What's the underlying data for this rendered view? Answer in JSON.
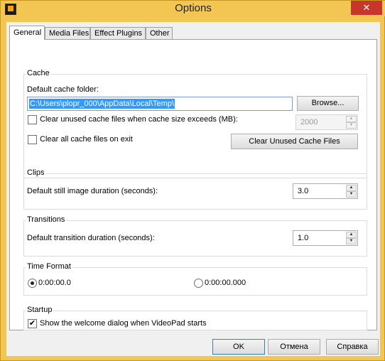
{
  "window": {
    "title": "Options",
    "close_glyph": "✕",
    "app_icon": "videopad-icon"
  },
  "tabs": [
    {
      "label": "General",
      "active": true
    },
    {
      "label": "Media Files",
      "active": false
    },
    {
      "label": "Effect Plugins",
      "active": false
    },
    {
      "label": "Other",
      "active": false
    }
  ],
  "cache": {
    "group_title": "Cache",
    "folder_label": "Default cache folder:",
    "folder_value": "C:\\Users\\plopr_000\\AppData\\Local\\Temp\\",
    "browse_label": "Browse...",
    "clear_unused_exceeds_label": "Clear unused cache files when cache size exceeds (MB):",
    "clear_unused_exceeds_checked": false,
    "cache_size_value": "2000",
    "clear_on_exit_label": "Clear all cache files on exit",
    "clear_on_exit_checked": false,
    "clear_unused_button": "Clear Unused Cache Files"
  },
  "clips": {
    "group_title": "Clips",
    "still_duration_label": "Default still image duration (seconds):",
    "still_duration_value": "3.0"
  },
  "transitions": {
    "group_title": "Transitions",
    "duration_label": "Default transition duration (seconds):",
    "duration_value": "1.0"
  },
  "time_format": {
    "group_title": "Time Format",
    "options": [
      {
        "label": "0:00:00.0",
        "selected": true
      },
      {
        "label": "0:00:00.000",
        "selected": false
      }
    ]
  },
  "startup": {
    "group_title": "Startup",
    "welcome_label": "Show the welcome dialog when VideoPad starts",
    "welcome_checked": true
  },
  "footer": {
    "ok": "OK",
    "cancel": "Отмена",
    "help": "Справка"
  },
  "glyphs": {
    "check": "✔",
    "spin_up": "▲",
    "spin_down": "▼"
  },
  "colors": {
    "title_bar": "#f3c654",
    "close_button": "#c7362b",
    "selection": "#3399ff"
  }
}
